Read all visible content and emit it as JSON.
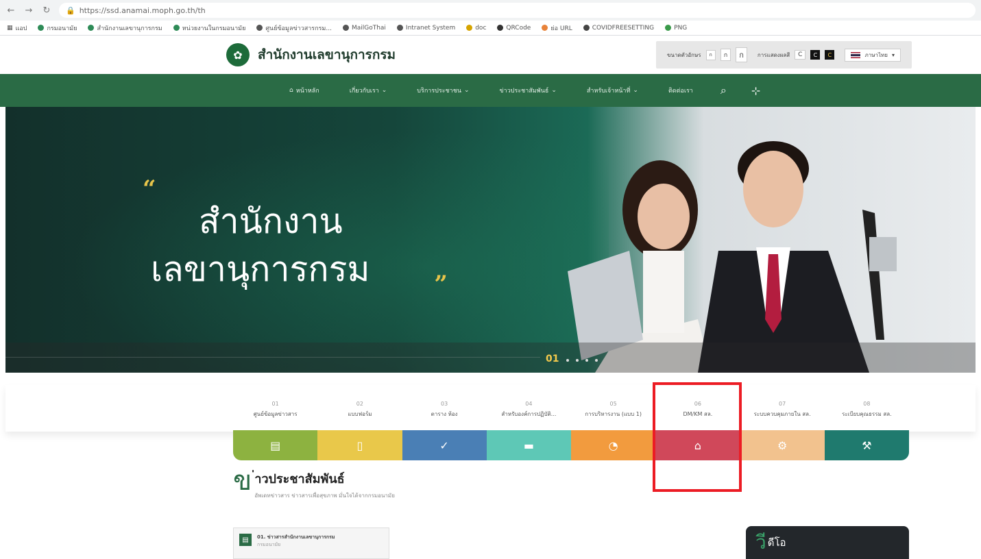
{
  "browser": {
    "url": "https://ssd.anamai.moph.go.th/th",
    "bookmarks": [
      "แอป",
      "กรมอนามัย",
      "สำนักงานเลขานุการกรม",
      "หน่วยงานในกรมอนามัย",
      "ศูนย์ข้อมูลข่าวสารกรม...",
      "MailGoThai",
      "Intranet System",
      "doc",
      "QRCode",
      "ย่อ URL",
      "COVIDFREESETTING",
      "PNG"
    ]
  },
  "header": {
    "site_title": "สำนักงานเลขานุการกรม",
    "font_size_label": "ขนาดตัวอักษร",
    "font_sizes": [
      "ก",
      "ก",
      "ก"
    ],
    "contrast_label": "การแสดงผลสี",
    "contrast_options": [
      "C",
      "C",
      "C"
    ],
    "language": "ภาษาไทย"
  },
  "nav": {
    "items": [
      "หน้าหลัก",
      "เกี่ยวกับเรา",
      "บริการประชาชน",
      "ข่าวประชาสัมพันธ์",
      "สำหรับเจ้าหน้าที่",
      "ติดต่อเรา"
    ]
  },
  "hero": {
    "line1": "สำนักงาน",
    "line2": "เลขานุการกรม",
    "quote_open": "“",
    "quote_close": "„",
    "slide_number": "01"
  },
  "service_tabs": [
    {
      "num": "01",
      "label": "ศูนย์ข้อมูลข่าวสาร"
    },
    {
      "num": "02",
      "label": "แบบฟอร์ม"
    },
    {
      "num": "03",
      "label": "ตาราง ห้อง"
    },
    {
      "num": "04",
      "label": "สำหรับองค์การปฏิบัติ..."
    },
    {
      "num": "05",
      "label": "การบริหารงาน (แบบ 1)"
    },
    {
      "num": "06",
      "label": "DM/KM สล."
    },
    {
      "num": "07",
      "label": "ระบบควบคุมภายใน สล."
    },
    {
      "num": "08",
      "label": "ระเบียบคุณธรรม สล."
    }
  ],
  "color_bar": {
    "colors": [
      "#8db240",
      "#e9c84a",
      "#4a7fb5",
      "#5ec8b6",
      "#f29b3e",
      "#d0485a",
      "#f2c28e",
      "#1f7a6e"
    ],
    "icons": [
      "clipboard-icon",
      "document-icon",
      "check-icon",
      "archive-icon",
      "pie-chart-icon",
      "graduation-cap-icon",
      "gear-icon",
      "hammer-icon"
    ]
  },
  "news": {
    "big_letter": "ข",
    "title": "่าวประชาสัมพันธ์",
    "subtitle": "อัพเดทข่าวสาร ข่าวสารเพื่อสุขภาพ มั่นใจได้จากกรมอนามัย",
    "card_title": "01. ข่าวสารสำนักงานเลขานุการกรม",
    "card_sub": "กรมอนามัย"
  },
  "video": {
    "big_letter": "วี",
    "title": "ดีโอ"
  }
}
